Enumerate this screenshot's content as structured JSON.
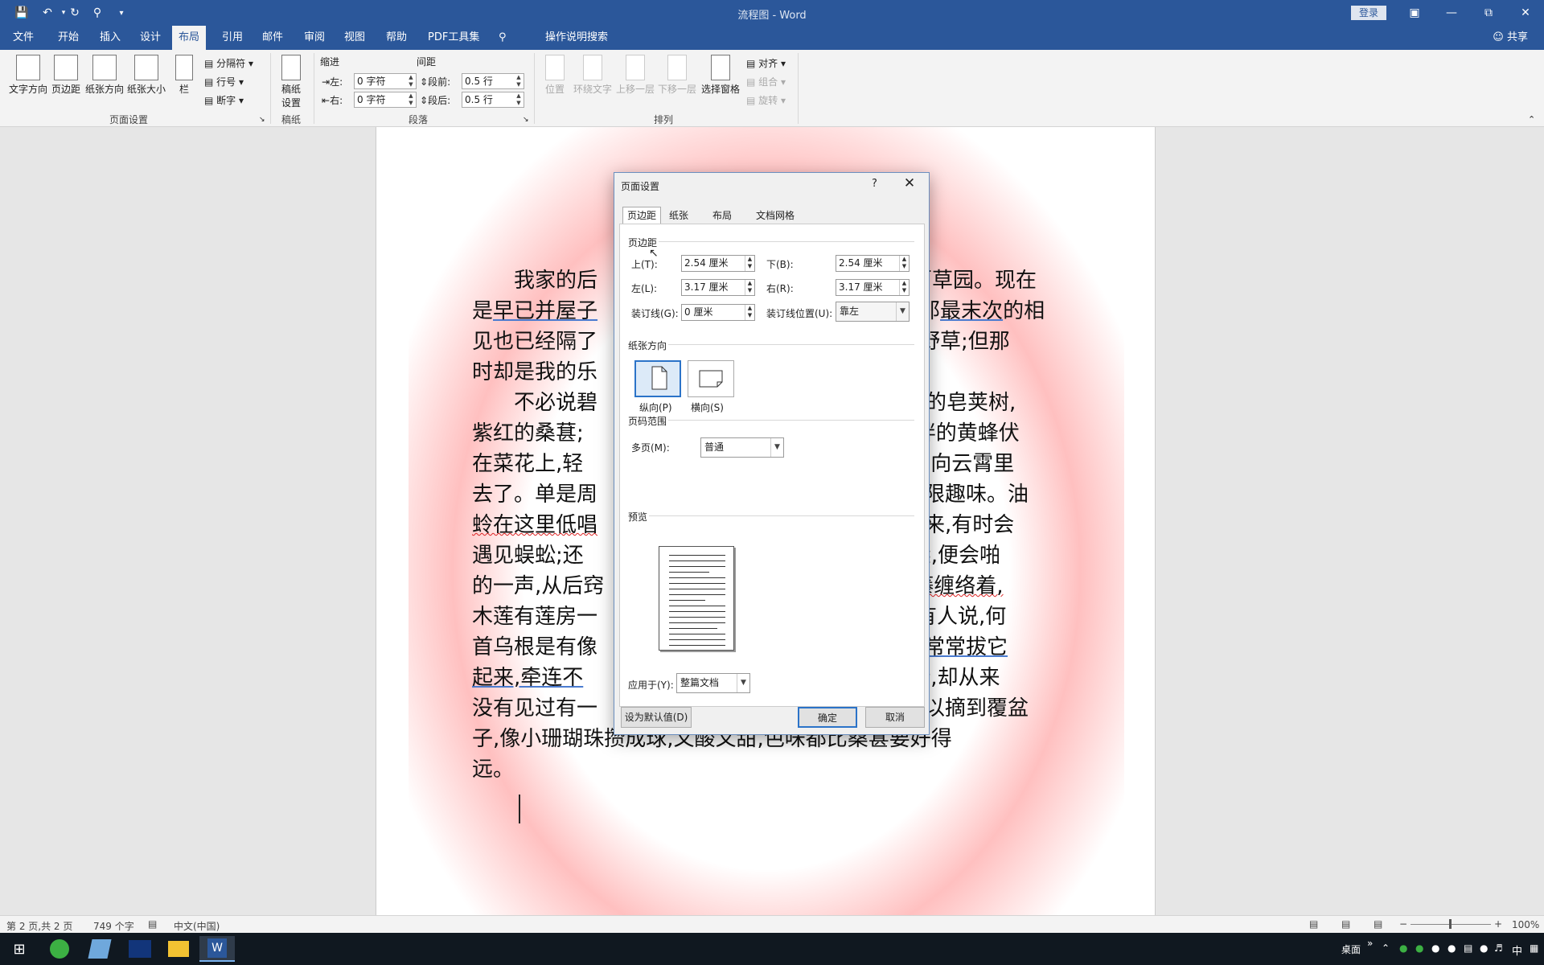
{
  "window": {
    "title": "流程图 - Word",
    "login_label": "登录",
    "share_label": "共享"
  },
  "menu_tabs": [
    "文件",
    "开始",
    "插入",
    "设计",
    "布局",
    "引用",
    "邮件",
    "审阅",
    "视图",
    "帮助",
    "PDF工具集"
  ],
  "active_tab": "布局",
  "tell_me": "操作说明搜索",
  "ribbon": {
    "text_direction": "文字方向",
    "margins": "页边距",
    "orientation": "纸张方向",
    "size": "纸张大小",
    "columns": "栏",
    "breaks": "分隔符",
    "line_numbers": "行号",
    "hyphenation": "断字",
    "group_page_setup": "页面设置",
    "manuscript": "稿纸\n设置",
    "manuscript_l1": "稿纸",
    "manuscript_l2": "设置",
    "group_manuscript": "稿纸",
    "indent_label": "缩进",
    "spacing_label": "间距",
    "indent_left_label": "左:",
    "indent_left_value": "0 字符",
    "indent_right_label": "右:",
    "indent_right_value": "0 字符",
    "space_before_label": "段前:",
    "space_before_value": "0.5 行",
    "space_after_label": "段后:",
    "space_after_value": "0.5 行",
    "group_paragraph": "段落",
    "position": "位置",
    "wrap_text": "环绕文字",
    "bring_forward": "上移一层",
    "send_backward": "下移一层",
    "selection_pane": "选择窗格",
    "align": "对齐",
    "group_obj": "组合",
    "rotate": "旋转",
    "group_arrange": "排列"
  },
  "document": {
    "p1": [
      "我家的后",
      "百草园。现在",
      "是",
      "早已并屋子",
      "那",
      "最末次",
      "的相",
      "见也已经隔了",
      "些野草;但那",
      "时却是我的乐"
    ],
    "p2_lines": [
      [
        "不必说碧",
        "大的皂荚树,"
      ],
      [
        "紫红的桑葚;",
        "肥胖的黄蜂伏"
      ],
      [
        "在菜花上,轻",
        "直窜向云霄里"
      ],
      [
        "去了。单是周",
        "无限趣味。油"
      ],
      [
        "蛉在这里低唱",
        "砖来,有时会"
      ],
      [
        "遇见蜈蚣;还",
        "脊梁,便会啪"
      ],
      [
        "的一声,从后窍",
        "莲藤缠络着,"
      ],
      [
        "木莲有莲房一",
        "有人说,何"
      ],
      [
        "首乌根是有像",
        "于是常常拔它"
      ],
      [
        "起来,牵连不",
        "泥墙,却从来"
      ],
      [
        "没有见过有一",
        "可以摘到覆盆"
      ],
      [
        "子,像小珊瑚珠攒成球,又酸又甜,色味都比桑葚要好得",
        ""
      ],
      [
        "远。",
        ""
      ]
    ]
  },
  "dialog": {
    "title": "页面设置",
    "help": "?",
    "tabs": [
      "页边距",
      "纸张",
      "布局",
      "文档网格"
    ],
    "active_tab": "页边距",
    "section_margins": "页边距",
    "top_label": "上(T):",
    "top_value": "2.54 厘米",
    "bottom_label": "下(B):",
    "bottom_value": "2.54 厘米",
    "left_label": "左(L):",
    "left_value": "3.17 厘米",
    "right_label": "右(R):",
    "right_value": "3.17 厘米",
    "gutter_label": "装订线(G):",
    "gutter_value": "0 厘米",
    "gutter_pos_label": "装订线位置(U):",
    "gutter_pos_value": "靠左",
    "section_orientation": "纸张方向",
    "portrait": "纵向(P)",
    "landscape": "横向(S)",
    "section_pages": "页码范围",
    "multiple_pages_label": "多页(M):",
    "multiple_pages_value": "普通",
    "section_preview": "预览",
    "apply_to_label": "应用于(Y):",
    "apply_to_value": "整篇文档",
    "set_default": "设为默认值(D)",
    "ok": "确定",
    "cancel": "取消"
  },
  "status": {
    "page": "第 2 页,共 2 页",
    "words": "749 个字",
    "language": "中文(中国)",
    "zoom": "100%"
  },
  "taskbar": {
    "tray_desktop": "桌面",
    "ime": "中"
  }
}
